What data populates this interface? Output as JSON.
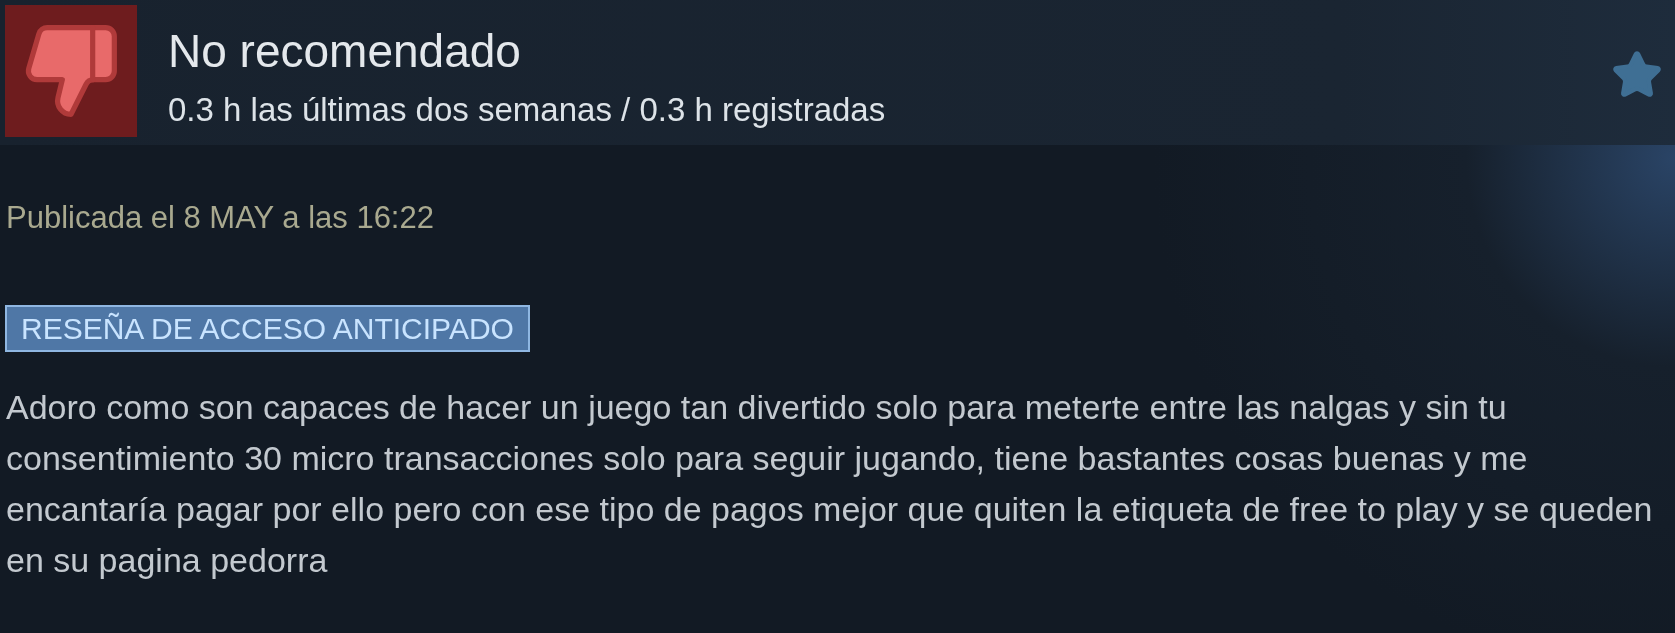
{
  "review": {
    "recommended": false,
    "title": "No recomendado",
    "playtime": "0.3 h las últimas dos semanas / 0.3 h registradas",
    "posted": "Publicada el 8 MAY a las 16:22",
    "badge": "RESEÑA DE ACCESO ANTICIPADO",
    "body": "Adoro como son capaces de hacer un juego tan divertido solo para meterte entre las nalgas y sin tu consentimiento 30 micro transacciones solo para seguir jugando, tiene bastantes cosas buenas y me encantaría pagar por ello pero con ese tipo de pagos mejor que quiten la etiqueta de free to play y se queden en su pagina pedorra"
  }
}
